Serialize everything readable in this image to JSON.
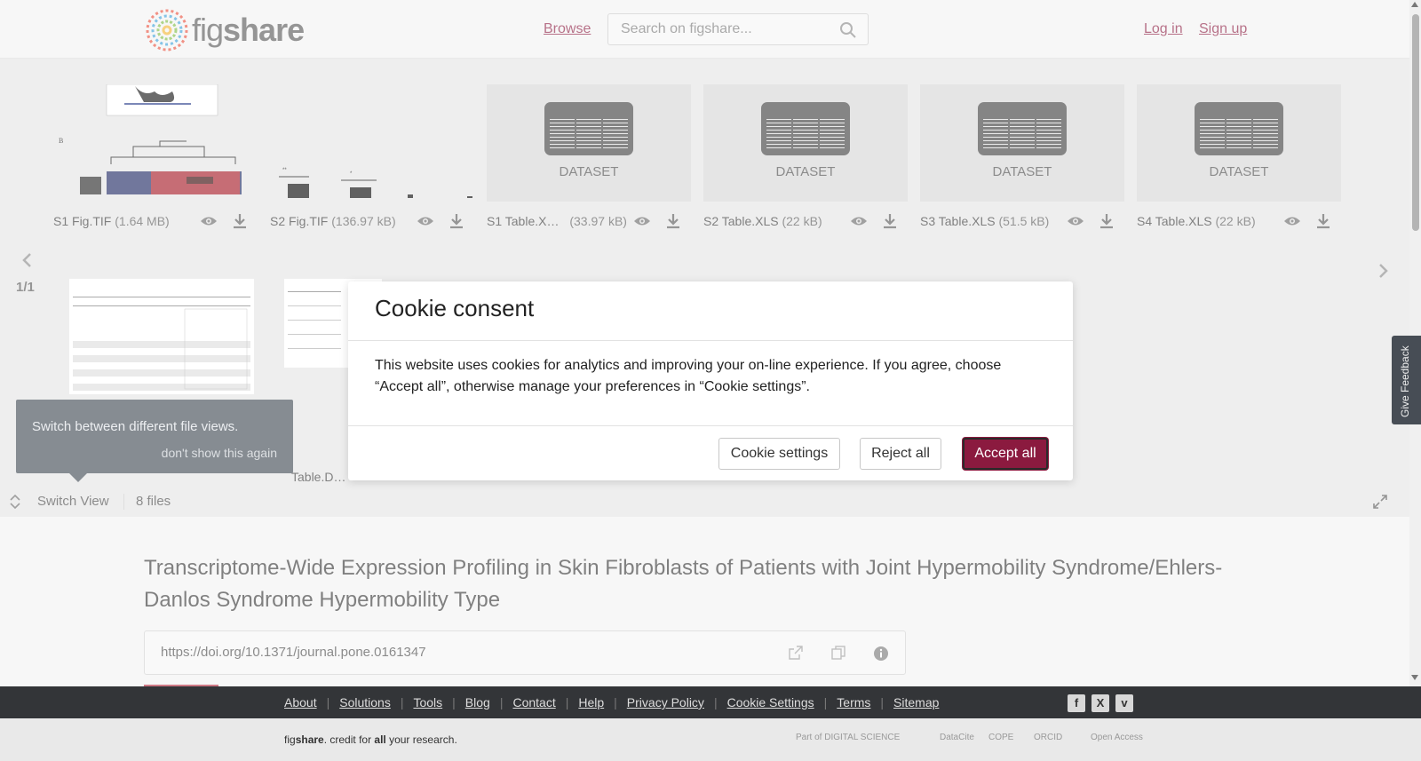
{
  "header": {
    "logo_text_light": "fig",
    "logo_text_bold": "share",
    "browse": "Browse",
    "search_placeholder": "Search on figshare...",
    "login": "Log in",
    "signup": "Sign up"
  },
  "viewer": {
    "files": [
      {
        "name": "S1 Fig.TIF",
        "size": "(1.64 MB)",
        "type": "image"
      },
      {
        "name": "S2 Fig.TIF",
        "size": "(136.97 kB)",
        "type": "image"
      },
      {
        "name": "S1 Table.X…",
        "size": "(33.97 kB)",
        "type": "dataset"
      },
      {
        "name": "S2 Table.XLS",
        "size": "(22 kB)",
        "type": "dataset"
      },
      {
        "name": "S3 Table.XLS",
        "size": "(51.5 kB)",
        "type": "dataset"
      },
      {
        "name": "S4 Table.XLS",
        "size": "(22 kB)",
        "type": "dataset"
      }
    ],
    "dataset_label": "DATASET",
    "page": "1/1",
    "peek_file_name": "Table.D…",
    "tooltip": {
      "text": "Switch between different file views.",
      "dismiss": "don't show this again"
    },
    "switch_view": "Switch View",
    "files_count": "8 files"
  },
  "article": {
    "title": "Transcriptome-Wide Expression Profiling in Skin Fibroblasts of Patients with Joint Hypermobility Syndrome/Ehlers-Danlos Syndrome Hypermobility Type",
    "doi": "https://doi.org/10.1371/journal.pone.0161347"
  },
  "cookie_modal": {
    "title": "Cookie consent",
    "body": "This website uses cookies for analytics and improving your on-line experience. If you agree, choose “Accept all”, otherwise manage your preferences in “Cookie settings”.",
    "settings_button": "Cookie settings",
    "reject_button": "Reject all",
    "accept_button": "Accept all"
  },
  "feedback": "Give Feedback",
  "footer": {
    "links": [
      "About",
      "Solutions",
      "Tools",
      "Blog",
      "Contact",
      "Help",
      "Privacy Policy",
      "Cookie Settings",
      "Terms",
      "Sitemap"
    ],
    "social": [
      "facebook-icon",
      "x-icon",
      "vimeo-icon"
    ],
    "tagline_prefix": "fig",
    "tagline_bold": "share",
    "tagline_mid": ". credit for ",
    "tagline_all": "all",
    "tagline_end": " your research.",
    "partners": [
      "Part of DIGITAL SCIENCE",
      "DataCite",
      "COPE",
      "ORCID",
      "Open Access"
    ]
  },
  "colors": {
    "brand": "#8b1a3f",
    "footer_bg": "#333538",
    "tooltip_bg": "#3d4650"
  }
}
